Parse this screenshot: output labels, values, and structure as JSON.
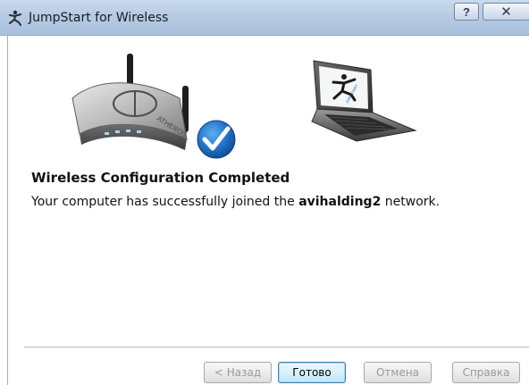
{
  "window": {
    "title": "JumpStart for Wireless",
    "help_glyph": "?",
    "close_glyph": "✕"
  },
  "main": {
    "heading": "Wireless Configuration Completed",
    "message_prefix": "Your computer has successfully joined the ",
    "network_name": "avihalding2",
    "message_suffix": " network."
  },
  "router_brand": "ATHEROS",
  "buttons": {
    "back": "< Назад",
    "done": "Готово",
    "cancel": "Отмена",
    "help": "Справка"
  },
  "colors": {
    "title_bar": "#b7cbe4",
    "check_badge": "#1f6fc4",
    "default_button_border": "#3c7fb1"
  }
}
